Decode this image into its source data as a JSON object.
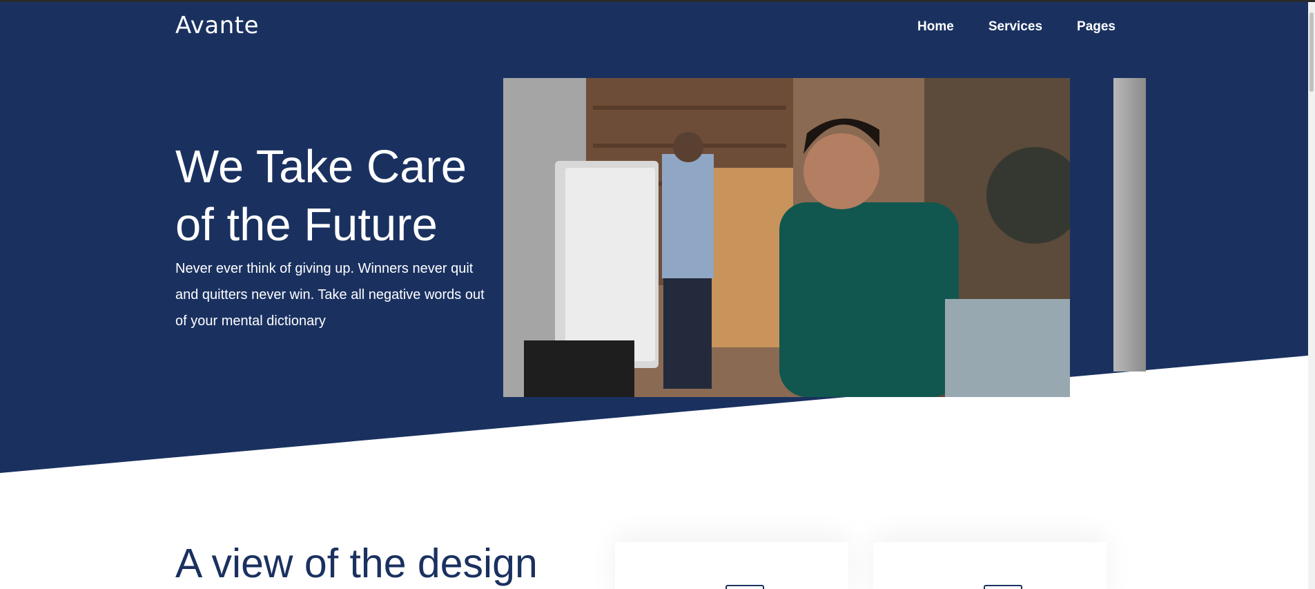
{
  "brand": {
    "logo_text": "Avante"
  },
  "nav": {
    "items": [
      {
        "label": "Home"
      },
      {
        "label": "Services"
      },
      {
        "label": "Pages"
      }
    ]
  },
  "hero": {
    "title": "We Take Care of the Future",
    "text": "Never ever think of giving up. Winners never quit and quitters never win. Take all negative words out of your mental dictionary"
  },
  "section": {
    "title": "A view of the design"
  },
  "colors": {
    "primary": "#1a3160",
    "text_light": "#ffffff",
    "background": "#ffffff"
  },
  "icons": {
    "card_icon": "monitor-icon"
  }
}
